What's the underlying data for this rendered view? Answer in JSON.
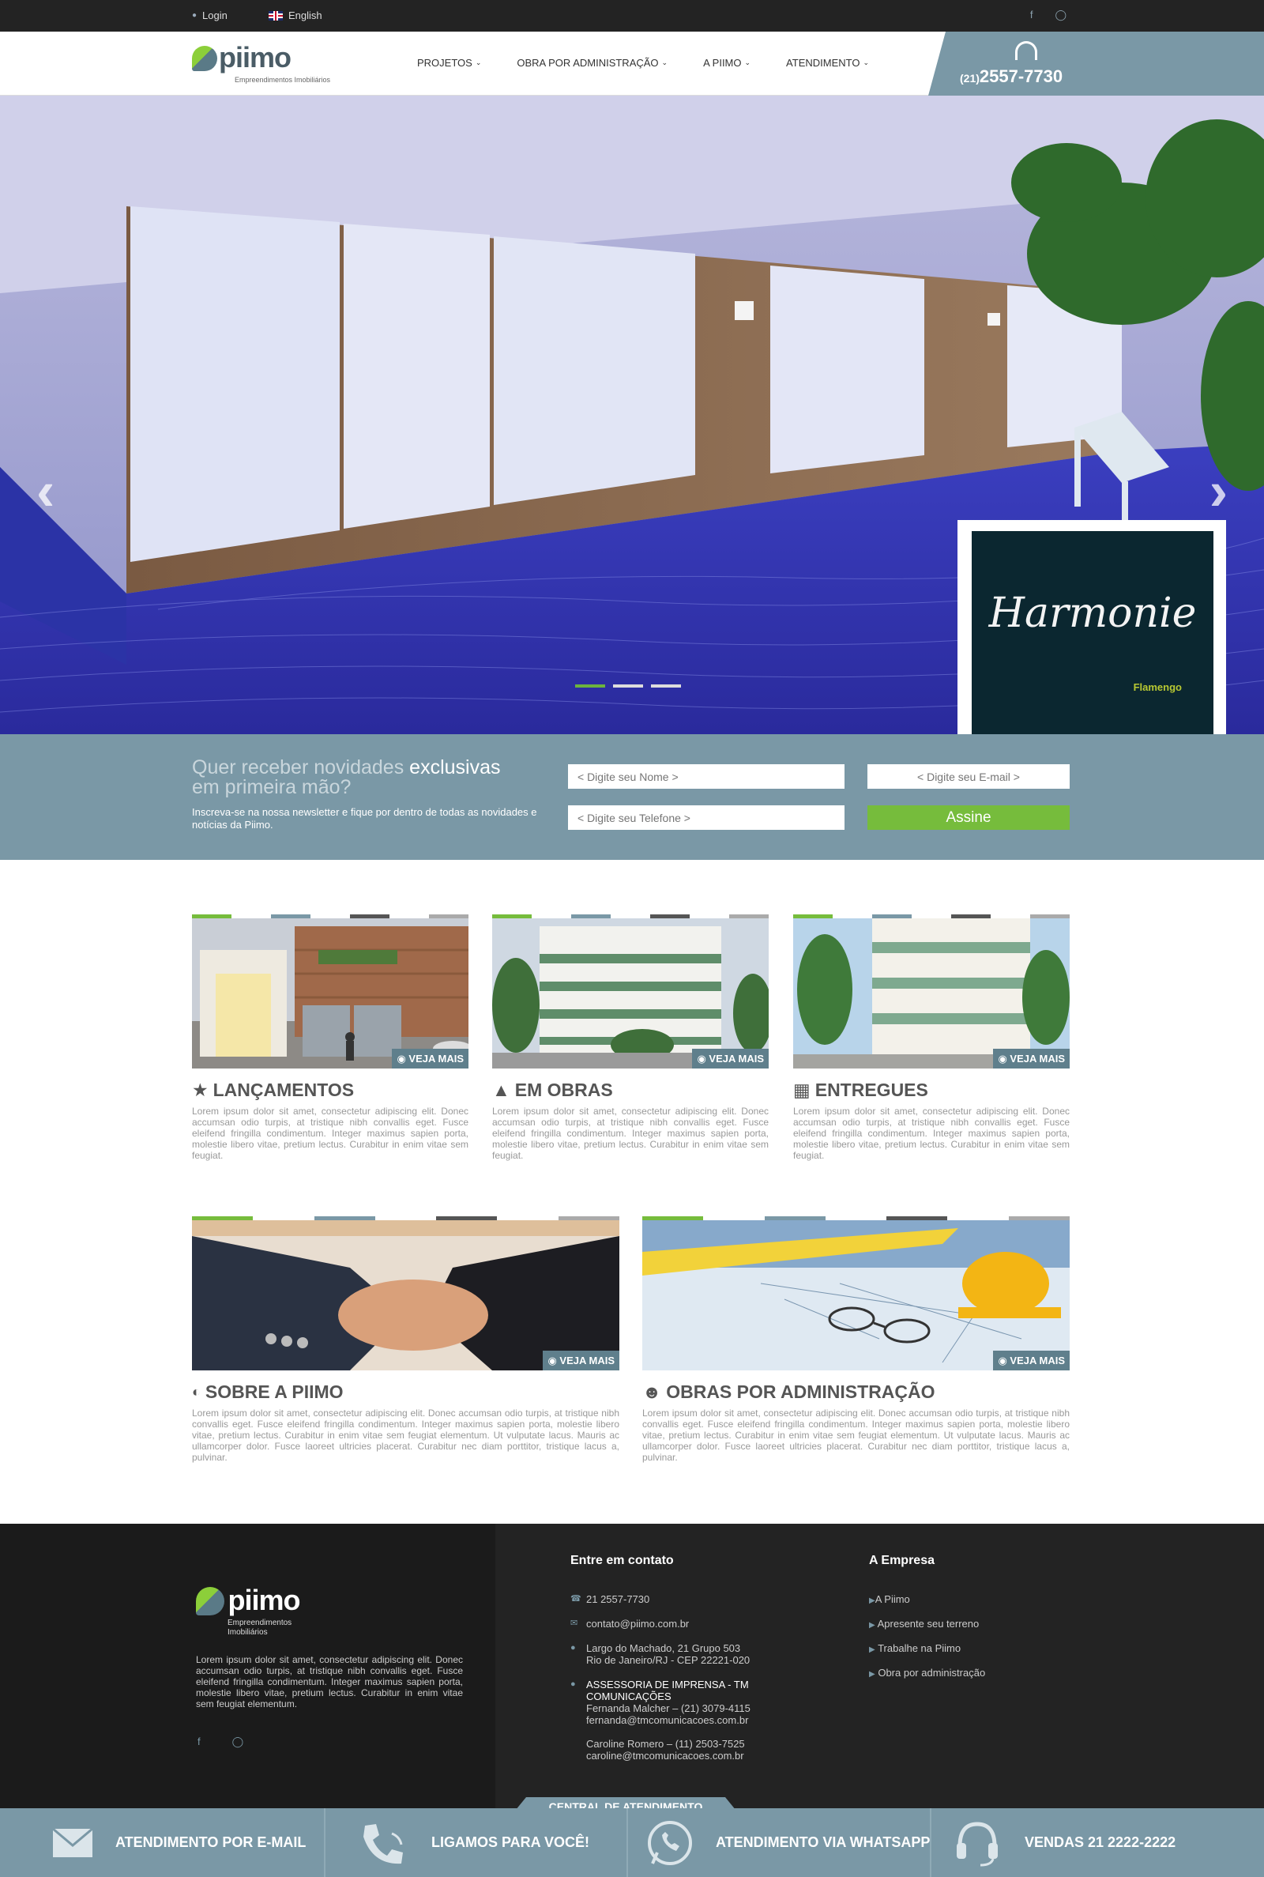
{
  "topbar": {
    "login": "Login",
    "language": "English",
    "social": {
      "facebook": "facebook-icon",
      "instagram": "instagram-icon"
    }
  },
  "header": {
    "logo_text": "piimo",
    "logo_subtitle": "Empreendimentos Imobiliários",
    "nav": [
      "PROJETOS",
      "OBRA POR ADMINISTRAÇÃO",
      "A PIIMO",
      "ATENDIMENTO"
    ],
    "phone_area": "(21)",
    "phone_number": "2557-7730"
  },
  "hero": {
    "promo_title": "Harmonie",
    "promo_subtitle": "Flamengo",
    "slides_total": 3,
    "active_slide": 1
  },
  "newsletter": {
    "heading_light": "Quer receber novidades",
    "heading_bold": "exclusivas",
    "heading_line2": "em primeira mão?",
    "text": "Inscreva-se na nossa newsletter e fique por dentro de todas as novidades e notícias da Piimo.",
    "name_placeholder": "< Digite seu Nome >",
    "email_placeholder": "< Digite seu E-mail >",
    "phone_placeholder": "< Digite seu Telefone >",
    "submit": "Assine"
  },
  "cards_row1": [
    {
      "title": "LANÇAMENTOS",
      "icon": "star-icon",
      "more": "VEJA MAIS",
      "text": "Lorem ipsum dolor sit amet, consectetur adipiscing elit. Donec accumsan odio turpis, at tristique nibh convallis eget. Fusce eleifend fringilla condimentum. Integer maximus sapien porta, molestie libero vitae, pretium lectus. Curabitur in enim vitae sem feugiat."
    },
    {
      "title": "EM OBRAS",
      "icon": "construction-icon",
      "more": "VEJA MAIS",
      "text": "Lorem ipsum dolor sit amet, consectetur adipiscing elit. Donec accumsan odio turpis, at tristique nibh convallis eget. Fusce eleifend fringilla condimentum. Integer maximus sapien porta, molestie libero vitae, pretium lectus. Curabitur in enim vitae sem feugiat."
    },
    {
      "title": "ENTREGUES",
      "icon": "building-icon",
      "more": "VEJA MAIS",
      "text": "Lorem ipsum dolor sit amet, consectetur adipiscing elit. Donec accumsan odio turpis, at tristique nibh convallis eget. Fusce eleifend fringilla condimentum. Integer maximus sapien porta, molestie libero vitae, pretium lectus. Curabitur in enim vitae sem feugiat."
    }
  ],
  "cards_row2": [
    {
      "title": "SOBRE A PIIMO",
      "icon": "piimo-icon",
      "more": "VEJA MAIS",
      "text": "Lorem ipsum dolor sit amet, consectetur adipiscing elit. Donec accumsan odio turpis, at tristique nibh convallis eget. Fusce eleifend fringilla condimentum. Integer maximus sapien porta, molestie libero vitae, pretium lectus. Curabitur in enim vitae sem feugiat elementum. Ut vulputate lacus. Mauris ac ullamcorper dolor. Fusce laoreet ultricies placerat. Curabitur nec diam porttitor, tristique lacus a, pulvinar."
    },
    {
      "title": "OBRAS POR ADMINISTRAÇÃO",
      "icon": "team-icon",
      "more": "VEJA MAIS",
      "text": "Lorem ipsum dolor sit amet, consectetur adipiscing elit. Donec accumsan odio turpis, at tristique nibh convallis eget. Fusce eleifend fringilla condimentum. Integer maximus sapien porta, molestie libero vitae, pretium lectus. Curabitur in enim vitae sem feugiat elementum. Ut vulputate lacus. Mauris ac ullamcorper dolor. Fusce laoreet ultricies placerat. Curabitur nec diam porttitor, tristique lacus a, pulvinar."
    }
  ],
  "footer": {
    "logo_text": "piimo",
    "logo_subtitle": "Empreendimentos Imobiliários",
    "about": "Lorem ipsum dolor sit amet, consectetur adipiscing elit. Donec accumsan odio turpis, at tristique nibh convallis eget. Fusce eleifend fringilla condimentum. Integer maximus sapien porta, molestie libero vitae, pretium lectus. Curabitur in enim vitae sem feugiat elementum.",
    "contact_title": "Entre em contato",
    "phone": "21 2557-7730",
    "email": "contato@piimo.com.br",
    "address_1": "Largo do Machado, 21 Grupo 503",
    "address_2": "Rio de Janeiro/RJ - CEP 22221-020",
    "press_title": "ASSESSORIA DE IMPRENSA - TM COMUNICAÇÕES",
    "press_1": "Fernanda Malcher – (21) 3079-4115",
    "press_1_email": "fernanda@tmcomunicacoes.com.br",
    "press_2": "Caroline Romero – (11) 2503-7525",
    "press_2_email": "caroline@tmcomunicacoes.com.br",
    "company_title": "A Empresa",
    "company_links": [
      "A Piimo",
      "Apresente seu terreno",
      "Trabalhe na Piimo",
      "Obra por administração"
    ]
  },
  "bottombar": {
    "tab": "CENTRAL DE ATENDIMENTO",
    "items": [
      "ATENDIMENTO POR E-MAIL",
      "LIGAMOS PARA VOCÊ!",
      "ATENDIMENTO VIA WHATSAPP",
      "VENDAS  21 2222-2222"
    ]
  },
  "colors": {
    "accent_green": "#76bc3c",
    "slate": "#7a98a6",
    "dark": "#232323"
  }
}
